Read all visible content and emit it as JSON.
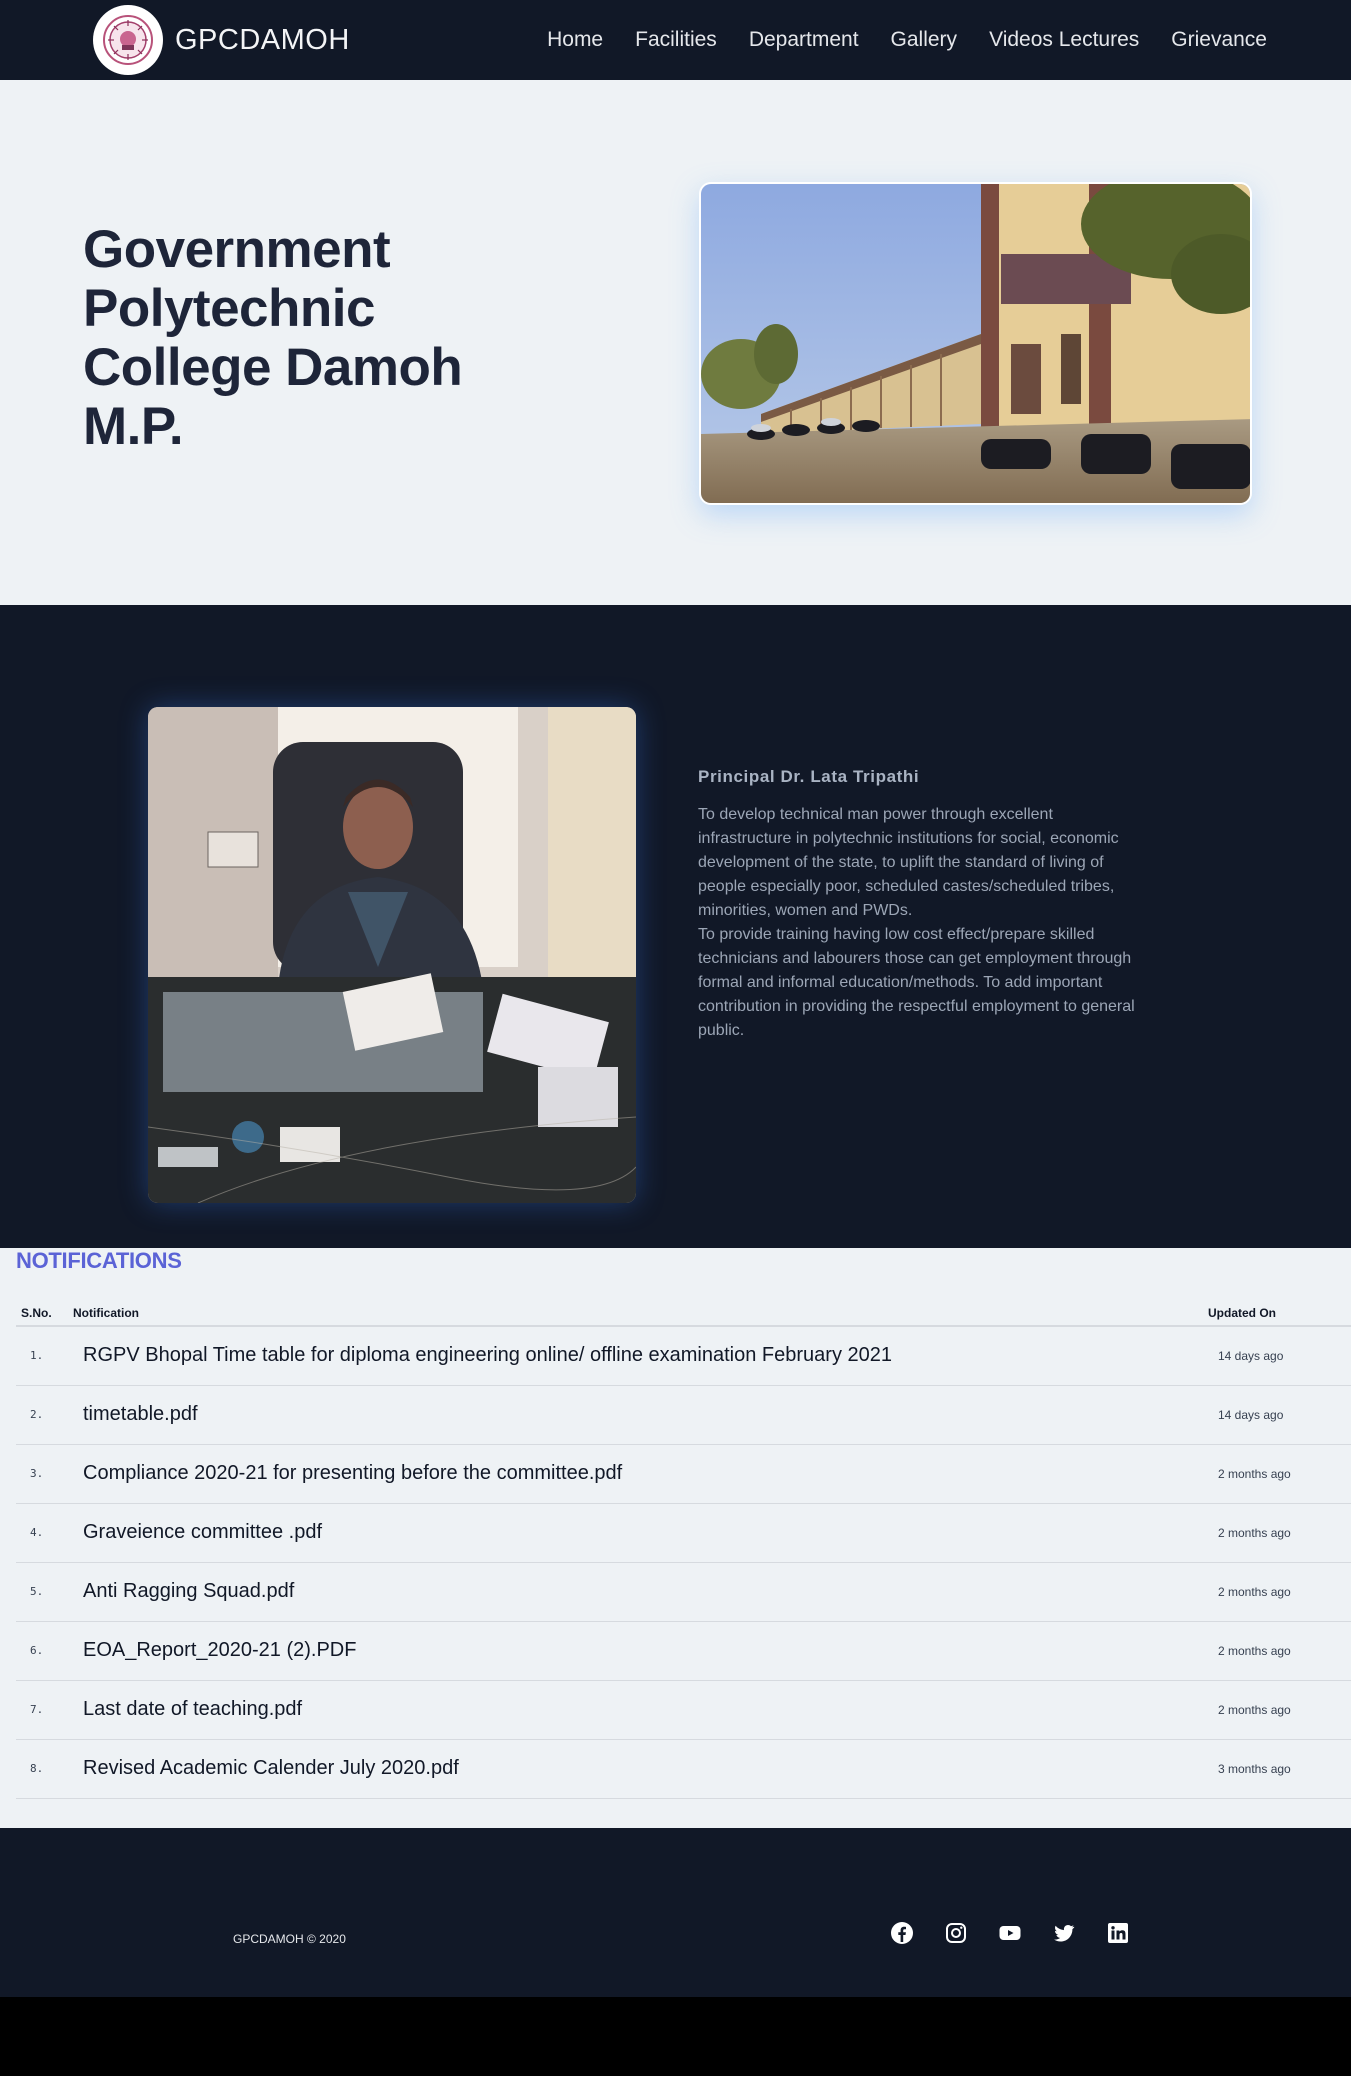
{
  "nav": {
    "brand": "GPCDAMOH",
    "items": [
      {
        "label": "Home"
      },
      {
        "label": "Facilities"
      },
      {
        "label": "Department"
      },
      {
        "label": "Gallery"
      },
      {
        "label": "Videos Lectures"
      },
      {
        "label": "Grievance"
      }
    ]
  },
  "hero": {
    "title": "Government Polytechnic College Damoh M.P."
  },
  "principal": {
    "name": "Principal Dr. Lata Tripathi",
    "text": "To develop technical man power through excellent infrastructure in polytechnic institutions for social, economic development of the state, to uplift the standard of living of people especially poor, scheduled castes/scheduled tribes, minorities, women and PWDs.\n To provide training having low cost effect/prepare skilled technicians and labourers those can get employment through formal and informal education/methods. To add important contribution in providing the respectful employment to general public."
  },
  "notifications": {
    "title": "NOTIFICATIONS",
    "columns": {
      "sno": "S.No.",
      "notification": "Notification",
      "updated": "Updated On"
    },
    "rows": [
      {
        "sno": "1.",
        "title": "RGPV Bhopal Time table for diploma engineering online/ offline examination February 2021",
        "updated": "14 days ago"
      },
      {
        "sno": "2.",
        "title": "timetable.pdf",
        "updated": "14 days ago"
      },
      {
        "sno": "3.",
        "title": "Compliance 2020-21 for presenting before the committee.pdf",
        "updated": "2 months ago"
      },
      {
        "sno": "4.",
        "title": "Graveience committee .pdf",
        "updated": "2 months ago"
      },
      {
        "sno": "5.",
        "title": "Anti Ragging Squad.pdf",
        "updated": "2 months ago"
      },
      {
        "sno": "6.",
        "title": "EOA_Report_2020-21 (2).PDF",
        "updated": "2 months ago"
      },
      {
        "sno": "7.",
        "title": "Last date of teaching.pdf",
        "updated": "2 months ago"
      },
      {
        "sno": "8.",
        "title": "Revised Academic Calender July 2020.pdf",
        "updated": "3 months ago"
      }
    ]
  },
  "footer": {
    "copyright": "GPCDAMOH © 2020",
    "socials": [
      "facebook-icon",
      "instagram-icon",
      "youtube-icon",
      "twitter-icon",
      "linkedin-icon"
    ]
  },
  "colors": {
    "nav_bg": "#111827",
    "page_bg": "#eef2f5",
    "heading": "#1e2539",
    "notif_title": "#5b63d6"
  }
}
